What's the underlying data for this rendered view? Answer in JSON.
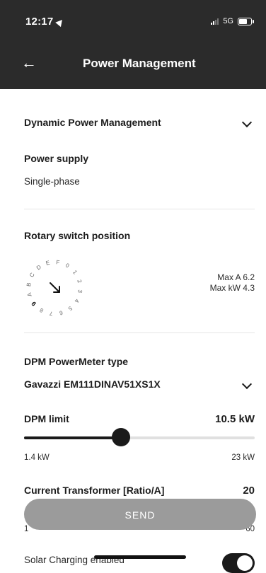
{
  "status_bar": {
    "time": "12:17",
    "network": "5G"
  },
  "header": {
    "title": "Power Management",
    "back_icon": "←"
  },
  "dpm_section": {
    "label": "Dynamic Power Management"
  },
  "power_supply": {
    "label": "Power supply",
    "value": "Single-phase"
  },
  "rotary": {
    "label": "Rotary switch position",
    "dial_labels": [
      "0",
      "1",
      "2",
      "3",
      "4",
      "5",
      "6",
      "7",
      "8",
      "9",
      "A",
      "B",
      "C",
      "D",
      "E",
      "F"
    ],
    "position": "9",
    "max_a": "Max A 6.2",
    "max_kw": "Max kW 4.3"
  },
  "powermeter": {
    "label": "DPM PowerMeter type",
    "value": "Gavazzi EM111DINAV51XS1X"
  },
  "dpm_limit": {
    "label": "DPM limit",
    "value": "10.5 kW",
    "min_label": "1.4 kW",
    "max_label": "23 kW",
    "fraction": 0.42
  },
  "ct": {
    "label": "Current Transformer [Ratio/A]",
    "value": "20",
    "min_label": "1",
    "max_label": "60"
  },
  "send": {
    "label": "SEND"
  },
  "solar": {
    "label": "Solar Charging enabled",
    "enabled": true
  },
  "colors": {
    "header_bg": "#2b2b2b",
    "accent": "#1a1a1a",
    "send_bg": "#9b9b9b"
  }
}
